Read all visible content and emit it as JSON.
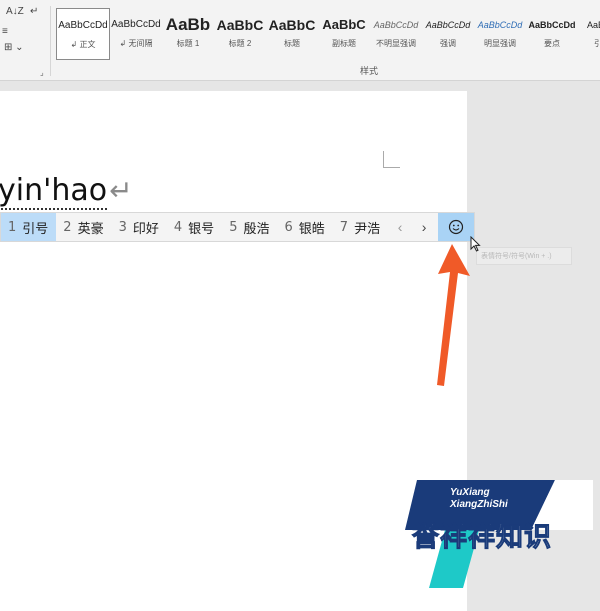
{
  "ribbon": {
    "section_label": "样式",
    "styles": [
      {
        "preview": "AaBbCcDd",
        "name": "正文",
        "selected": true
      },
      {
        "preview": "AaBbCcDd",
        "name": "无间隔"
      },
      {
        "preview": "AaBb",
        "name": "标题 1"
      },
      {
        "preview": "AaBbC",
        "name": "标题 2"
      },
      {
        "preview": "AaBbC",
        "name": "标题"
      },
      {
        "preview": "AaBbC",
        "name": "副标题"
      },
      {
        "preview": "AaBbCcDd",
        "name": "不明显强调"
      },
      {
        "preview": "AaBbCcDd",
        "name": "强调"
      },
      {
        "preview": "AaBbCcDd",
        "name": "明显强调"
      },
      {
        "preview": "AaBbCcDd",
        "name": "要点"
      },
      {
        "preview": "AaBb",
        "name": "引"
      }
    ]
  },
  "document": {
    "typed_text": "yin'hao",
    "paragraph_mark": "↵"
  },
  "ime": {
    "candidates": [
      {
        "num": "1",
        "text": "引号"
      },
      {
        "num": "2",
        "text": "英豪"
      },
      {
        "num": "3",
        "text": "印好"
      },
      {
        "num": "4",
        "text": "银号"
      },
      {
        "num": "5",
        "text": "殷浩"
      },
      {
        "num": "6",
        "text": "银皓"
      },
      {
        "num": "7",
        "text": "尹浩"
      }
    ],
    "prev": "‹",
    "next": "›",
    "emoji_icon": "smiley-icon",
    "tooltip": "表情符号/符号(Win + .)"
  },
  "watermark": {
    "en_line1": "YuXiang",
    "en_line2": "XiangZhiShi",
    "cn": "誉祥祥知识"
  },
  "colors": {
    "ime_active": "#bcdcf8",
    "emoji_button": "#a9d3f5",
    "arrow": "#f05a28",
    "watermark_blue": "#1a3b7a",
    "watermark_cyan": "#1ec9c8"
  }
}
